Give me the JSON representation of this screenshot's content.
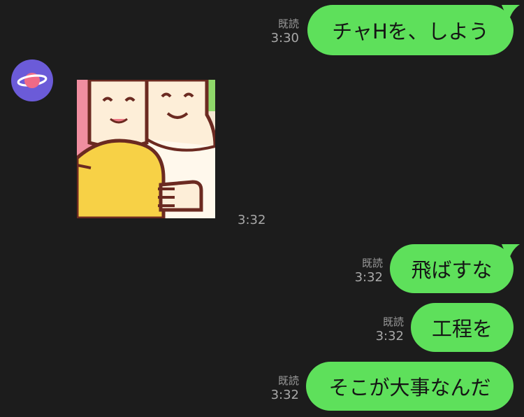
{
  "messages": [
    {
      "read_label": "既読",
      "time": "3:30",
      "text": "チャHを、しよう"
    },
    {
      "read_label": "既読",
      "time": "3:32",
      "text": "飛ばすな"
    },
    {
      "read_label": "既読",
      "time": "3:32",
      "text": "工程を"
    },
    {
      "read_label": "既読",
      "time": "3:32",
      "text": "そこが大事なんだ"
    }
  ],
  "incoming": {
    "sticker_time": "3:32",
    "avatar_icon": "planet-icon",
    "sticker_icon": "couple-sticker-icon"
  },
  "colors": {
    "background": "#1c1c1c",
    "bubble_green": "#5ee05b",
    "avatar_purple": "#6b5bd8"
  }
}
